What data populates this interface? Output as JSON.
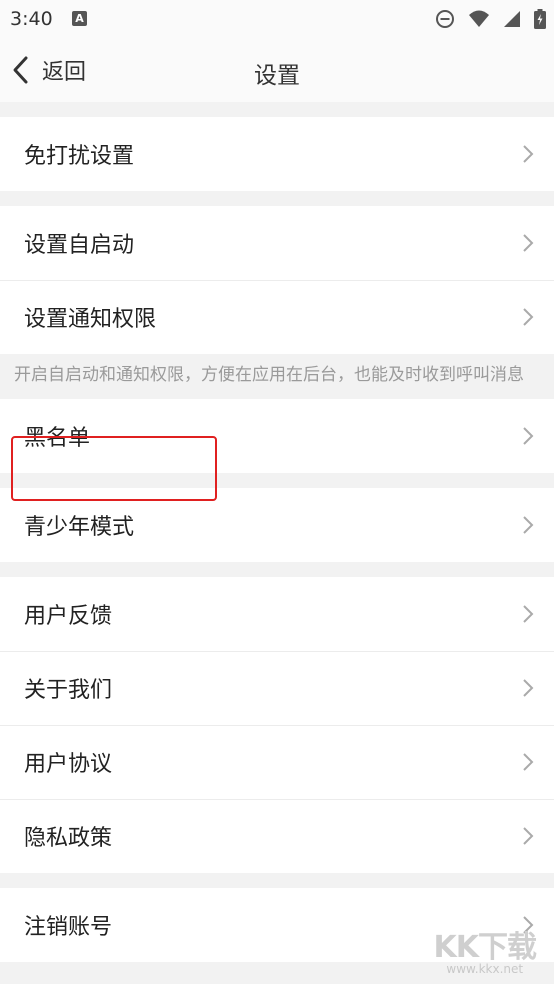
{
  "status_bar": {
    "time": "3:40",
    "notif_glyph": "A"
  },
  "nav": {
    "back_label": "返回",
    "title": "设置"
  },
  "groups": [
    {
      "items": [
        {
          "label": "免打扰设置"
        }
      ]
    },
    {
      "items": [
        {
          "label": "设置自启动"
        },
        {
          "label": "设置通知权限"
        }
      ]
    },
    {
      "items": [
        {
          "label": "黑名单"
        }
      ]
    },
    {
      "items": [
        {
          "label": "青少年模式"
        }
      ]
    },
    {
      "items": [
        {
          "label": "用户反馈"
        },
        {
          "label": "关于我们"
        },
        {
          "label": "用户协议"
        },
        {
          "label": "隐私政策"
        }
      ]
    },
    {
      "items": [
        {
          "label": "注销账号"
        }
      ]
    }
  ],
  "hint_text": "开启自启动和通知权限，方便在应用在后台，也能及时收到呼叫消息",
  "watermark": {
    "logo": "KK下载",
    "url": "www.kkx.net"
  },
  "colors": {
    "highlight": "#e02020",
    "background": "#f2f2f2",
    "row": "#ffffff"
  },
  "icons": {
    "back": "chevron-left-icon",
    "row": "chevron-right-icon",
    "status": [
      "dnd-icon",
      "wifi-icon",
      "signal-icon",
      "battery-icon"
    ]
  }
}
